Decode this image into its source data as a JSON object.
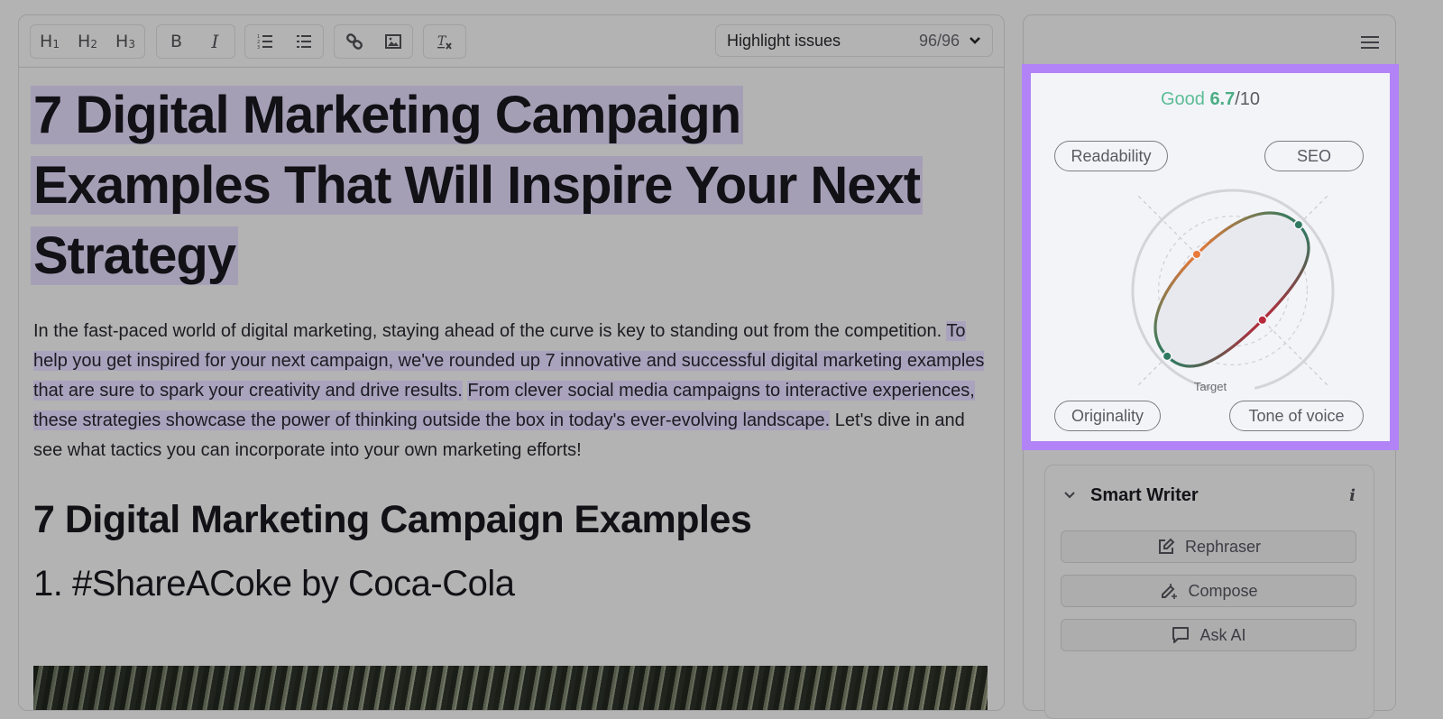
{
  "toolbar": {
    "heading_buttons": [
      {
        "name": "h1",
        "label": "H",
        "sub": "1"
      },
      {
        "name": "h2",
        "label": "H",
        "sub": "2"
      },
      {
        "name": "h3",
        "label": "H",
        "sub": "3"
      }
    ],
    "format_icons": [
      "bold-icon",
      "italic-icon",
      "ordered-list-icon",
      "bullet-list-icon",
      "link-icon",
      "image-icon",
      "clear-format-icon"
    ],
    "bold_label": "B",
    "italic_label": "I",
    "highlight": {
      "label": "Highlight issues",
      "count": "96/96"
    }
  },
  "document": {
    "title": "7 Digital Marketing Campaign Examples That Will Inspire Your Next Strategy",
    "intro": {
      "plain_start": "In the fast-paced world of digital marketing, staying ahead of the curve is key to standing out from the competition. ",
      "highlight_1": "To help you get inspired for your next campaign, we've rounded up 7 innovative and successful digital marketing examples that are sure to spark your creativity and drive results.",
      "highlight_2": "From clever social media campaigns to interactive experiences, these strategies showcase the power of thinking outside the box in today's ever-evolving landscape.",
      "plain_end": " Let's dive in and see what tactics you can incorporate into your own marketing efforts!"
    },
    "section_heading": "7 Digital Marketing Campaign Examples",
    "subheading": "1. #ShareACoke by Coca-Cola",
    "image_alt": "Palm trees photo"
  },
  "score": {
    "rating": "Good",
    "value": "6.7",
    "max": "/10",
    "target_label": "Target",
    "colors": {
      "good": "#2f7a5f",
      "warn": "#e8793a",
      "bad": "#b8283a",
      "accent": "#b183f6"
    }
  },
  "chart_data": {
    "type": "radar",
    "title": "Good 6.7/10",
    "axes": [
      "Readability",
      "SEO",
      "Tone of voice",
      "Originality"
    ],
    "values": [
      0.55,
      1.0,
      0.45,
      1.0
    ],
    "status": [
      "warn",
      "good",
      "bad",
      "good"
    ],
    "range": [
      0,
      1
    ],
    "target": 1.0,
    "rings": 3
  },
  "smart_writer": {
    "title": "Smart Writer",
    "info_label": "i",
    "buttons": [
      {
        "label": "Rephraser",
        "icon": "edit-icon"
      },
      {
        "label": "Compose",
        "icon": "magic-pen-icon"
      },
      {
        "label": "Ask AI",
        "icon": "chat-icon"
      }
    ]
  }
}
